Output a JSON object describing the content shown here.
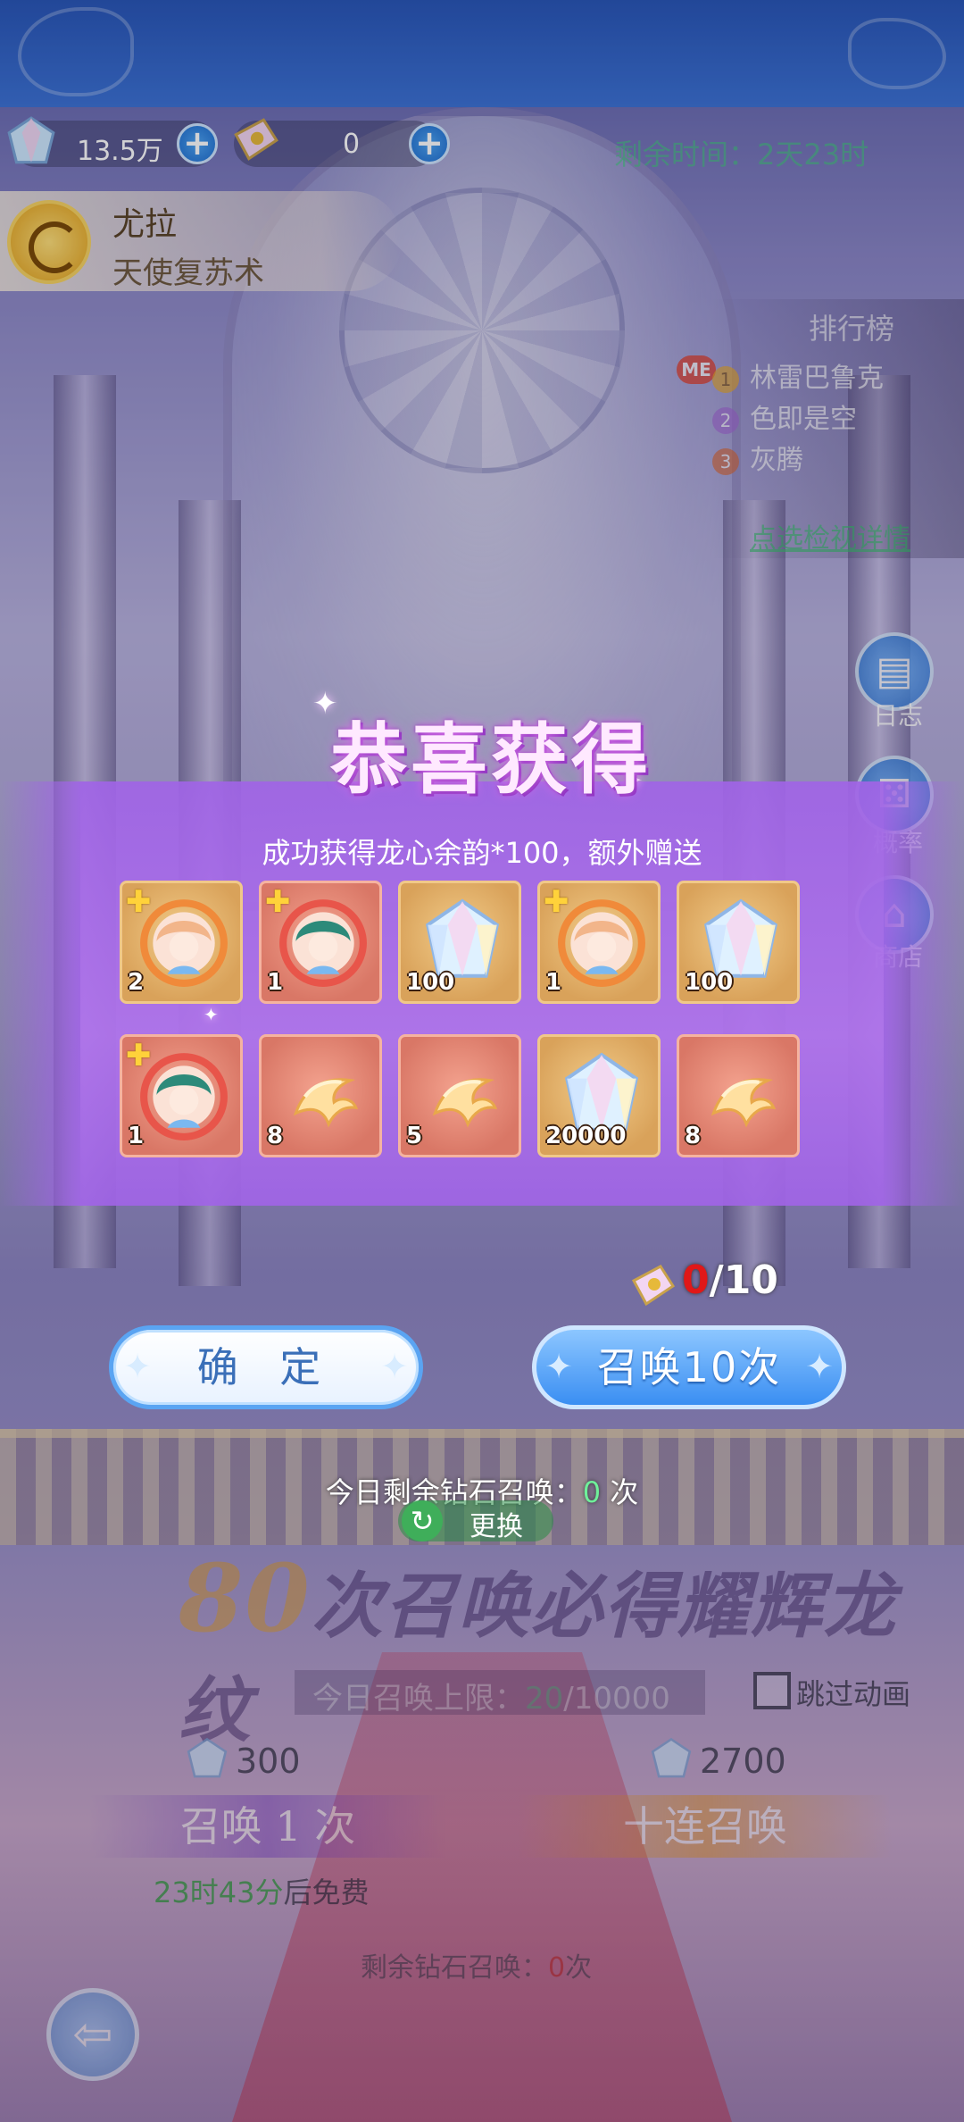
{
  "currency": [
    {
      "value": "13.5万",
      "icon": "diamond-icon"
    },
    {
      "value": "0",
      "icon": "summon-ticket-icon"
    }
  ],
  "timer": "剩余时间：2天23时",
  "hero": {
    "name": "尤拉",
    "skill": "天使复苏术"
  },
  "ranking": {
    "title": "排行榜",
    "me_tag": "ME",
    "entries": [
      {
        "rank": "1",
        "name": "林雷巴鲁克"
      },
      {
        "rank": "2",
        "name": "色即是空"
      },
      {
        "rank": "3",
        "name": "灰腾"
      }
    ],
    "link": "点选检视详情"
  },
  "side_buttons": [
    {
      "label": "日志",
      "icon": "log-book-icon"
    },
    {
      "label": "概率",
      "icon": "dice-icon"
    },
    {
      "label": "商店",
      "icon": "shop-icon"
    }
  ],
  "modal": {
    "title": "恭喜获得",
    "message": "成功获得龙心余韵*100，额外赠送",
    "items": [
      {
        "qty": "2",
        "bg": "gold",
        "kind": "character-shard",
        "puzzle": true,
        "hair": "#f2b58a"
      },
      {
        "qty": "1",
        "bg": "red",
        "kind": "character-shard",
        "puzzle": true,
        "hair": "#2d8a7a"
      },
      {
        "qty": "100",
        "bg": "gold",
        "kind": "diamond",
        "puzzle": false
      },
      {
        "qty": "1",
        "bg": "gold",
        "kind": "character-shard",
        "puzzle": true,
        "hair": "#f2b58a"
      },
      {
        "qty": "100",
        "bg": "gold",
        "kind": "diamond",
        "puzzle": false
      },
      {
        "qty": "1",
        "bg": "red",
        "kind": "character-shard",
        "puzzle": true,
        "hair": "#2d8a7a"
      },
      {
        "qty": "8",
        "bg": "red",
        "kind": "dragon-pattern",
        "puzzle": false
      },
      {
        "qty": "5",
        "bg": "red",
        "kind": "dragon-pattern",
        "puzzle": false
      },
      {
        "qty": "20000",
        "bg": "gold",
        "kind": "diamond",
        "puzzle": false
      },
      {
        "qty": "8",
        "bg": "red",
        "kind": "dragon-pattern",
        "puzzle": false
      }
    ],
    "progress": {
      "current": "0",
      "total": "/10"
    },
    "confirm_label": "确 定",
    "summon10_label": "召唤10次",
    "today_remain_prefix": "今日剩余钻石召唤：",
    "today_remain_count": "0",
    "today_remain_suffix": " 次",
    "change_label": "更换"
  },
  "background": {
    "promo_number": "80",
    "promo_text": "次召唤必得耀辉龙纹",
    "limit_prefix": "今日召唤上限：",
    "limit_current": "20",
    "limit_total": "/10000",
    "skip_label": "跳过动画",
    "cost_single": "300",
    "cost_ten": "2700",
    "summon_one_label": "召唤 1 次",
    "summon_ten_label": "十连召唤",
    "free_time": "23时43分",
    "free_suffix": "后免费",
    "remain_prefix": "剩余钻石召唤：",
    "remain_count": "0",
    "remain_suffix": "次"
  },
  "colors": {
    "accent_blue": "#3a8ef2",
    "modal_purple": "#a96ee6",
    "green_text": "#3fd07a",
    "red_text": "#e01818"
  }
}
